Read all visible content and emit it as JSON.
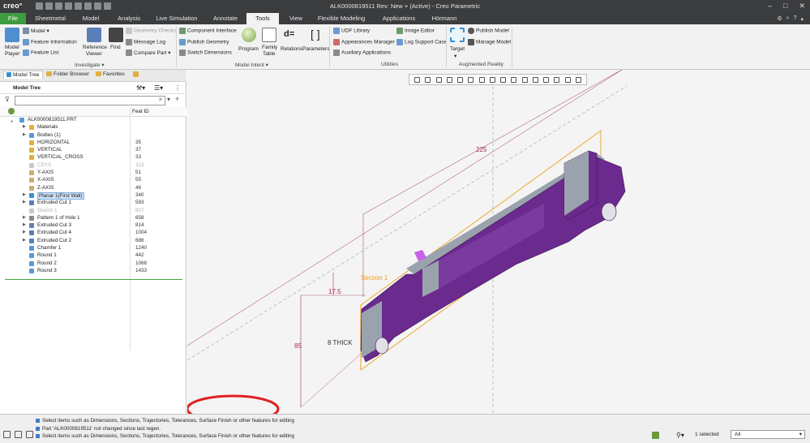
{
  "app": {
    "logo": "creo°",
    "window_title": "ALK0000819511 Rev: New + (Active) - Creo Parametric",
    "window_controls": [
      "–",
      "□",
      "✕"
    ]
  },
  "tabs": [
    "File",
    "Sheetmetal",
    "Model",
    "Analysis",
    "Live Simulation",
    "Annotate",
    "Tools",
    "View",
    "Flexible Modeling",
    "Applications",
    "Hörmann"
  ],
  "active_tab": "Tools",
  "ribbon": {
    "model_player": [
      "Model",
      "Player"
    ],
    "model_label": "Model",
    "feature_information": "Feature Information",
    "feature_list": "Feature List",
    "reference_viewer": [
      "Reference",
      "Viewer"
    ],
    "find": "Find",
    "geometry_checks": "Geometry Checks",
    "message_log": "Message Log",
    "compare_part": "Compare Part",
    "group_investigate": "Investigate",
    "component_interface": "Component Interface",
    "publish_geometry": "Publish Geometry",
    "switch_dimensions": "Switch Dimensions",
    "program": "Program",
    "family_table": [
      "Family",
      "Table"
    ],
    "relations": "Relations",
    "parameters": "Parameters",
    "group_model_intent": "Model Intent",
    "udf_library": "UDF Library",
    "appearances_manager": "Appearances Manager",
    "auxiliary_applications": "Auxiliary Applications",
    "image_editor": "Image Editor",
    "log_support_case": "Log Support Case",
    "group_utilities": "Utilities",
    "target": "Target",
    "publish_model": "Publish Model",
    "manage_model": "Manage Model",
    "group_augmented_reality": "Augmented Reality"
  },
  "panel": {
    "tabs": [
      "Model Tree",
      "Folder Browser",
      "Favorites"
    ],
    "title": "Model Tree",
    "filter_placeholder": "",
    "col_feat_id": "Feat ID",
    "root": "ALK0000819511.PRT",
    "items": [
      {
        "label": "Materials",
        "id": "",
        "expand": true,
        "icon": "folder",
        "dim": false,
        "sel": false
      },
      {
        "label": "Bodies (1)",
        "id": "",
        "expand": true,
        "icon": "bodies",
        "dim": false,
        "sel": false
      },
      {
        "label": "HORIZONTAL",
        "id": "35",
        "expand": false,
        "icon": "plane",
        "dim": false,
        "sel": false
      },
      {
        "label": "VERTICAL",
        "id": "37",
        "expand": false,
        "icon": "plane",
        "dim": false,
        "sel": false
      },
      {
        "label": "VERTICAL_CROSS",
        "id": "33",
        "expand": false,
        "icon": "plane",
        "dim": false,
        "sel": false
      },
      {
        "label": "CSYS",
        "id": "313",
        "expand": false,
        "icon": "csys",
        "dim": true,
        "sel": false
      },
      {
        "label": "Y-AXIS",
        "id": "51",
        "expand": false,
        "icon": "axis",
        "dim": false,
        "sel": false
      },
      {
        "label": "X-AXIS",
        "id": "55",
        "expand": false,
        "icon": "axis",
        "dim": false,
        "sel": false
      },
      {
        "label": "Z-AXIS",
        "id": "46",
        "expand": false,
        "icon": "axis",
        "dim": false,
        "sel": false
      },
      {
        "label": "Planar 1(First Wall)",
        "id": "340",
        "expand": true,
        "icon": "wall",
        "dim": false,
        "sel": true
      },
      {
        "label": "Extruded Cut 1",
        "id": "593",
        "expand": true,
        "icon": "cut",
        "dim": false,
        "sel": false
      },
      {
        "label": "Sketch 1",
        "id": "607",
        "expand": false,
        "icon": "sketch",
        "dim": true,
        "sel": false
      },
      {
        "label": "Pattern 1 of Hole 1",
        "id": "658",
        "expand": true,
        "icon": "pattern",
        "dim": false,
        "sel": false
      },
      {
        "label": "Extruded Cut 3",
        "id": "814",
        "expand": true,
        "icon": "cut",
        "dim": false,
        "sel": false
      },
      {
        "label": "Extruded Cut 4",
        "id": "1004",
        "expand": true,
        "icon": "cut",
        "dim": false,
        "sel": false
      },
      {
        "label": "Extruded Cut 2",
        "id": "686",
        "expand": true,
        "icon": "cut",
        "dim": false,
        "sel": false
      },
      {
        "label": "Chamfer 1",
        "id": "1240",
        "expand": false,
        "icon": "chamfer",
        "dim": false,
        "sel": false
      },
      {
        "label": "Round 1",
        "id": "442",
        "expand": false,
        "icon": "round",
        "dim": false,
        "sel": false
      },
      {
        "label": "Round 2",
        "id": "1068",
        "expand": false,
        "icon": "round",
        "dim": false,
        "sel": false
      },
      {
        "label": "Round 3",
        "id": "1433",
        "expand": false,
        "icon": "round",
        "dim": false,
        "sel": false
      }
    ]
  },
  "viewport": {
    "dim_225": "225",
    "dim_17_5": "17.5",
    "dim_85": "85",
    "thick_label": "8 THICK",
    "section_label": "Section 1",
    "colors": {
      "part": "#6b2a8e",
      "part_dark": "#4f1d6a",
      "edge_gray": "#9aa3ad",
      "section": "#f0a020",
      "dimension": "#a03050",
      "annotation_circle": "#e02020"
    }
  },
  "status": {
    "messages": [
      "Select items such as Dimensions, Sections, Trajectories, Tolerances, Surface Finish or other features for editing",
      "Part 'ALK0000819511' not changed since last regen.",
      "Select items such as Dimensions, Sections, Trajectories, Tolerances, Surface Finish or other features for editing"
    ],
    "selected": "1 selected",
    "filter": "All"
  }
}
